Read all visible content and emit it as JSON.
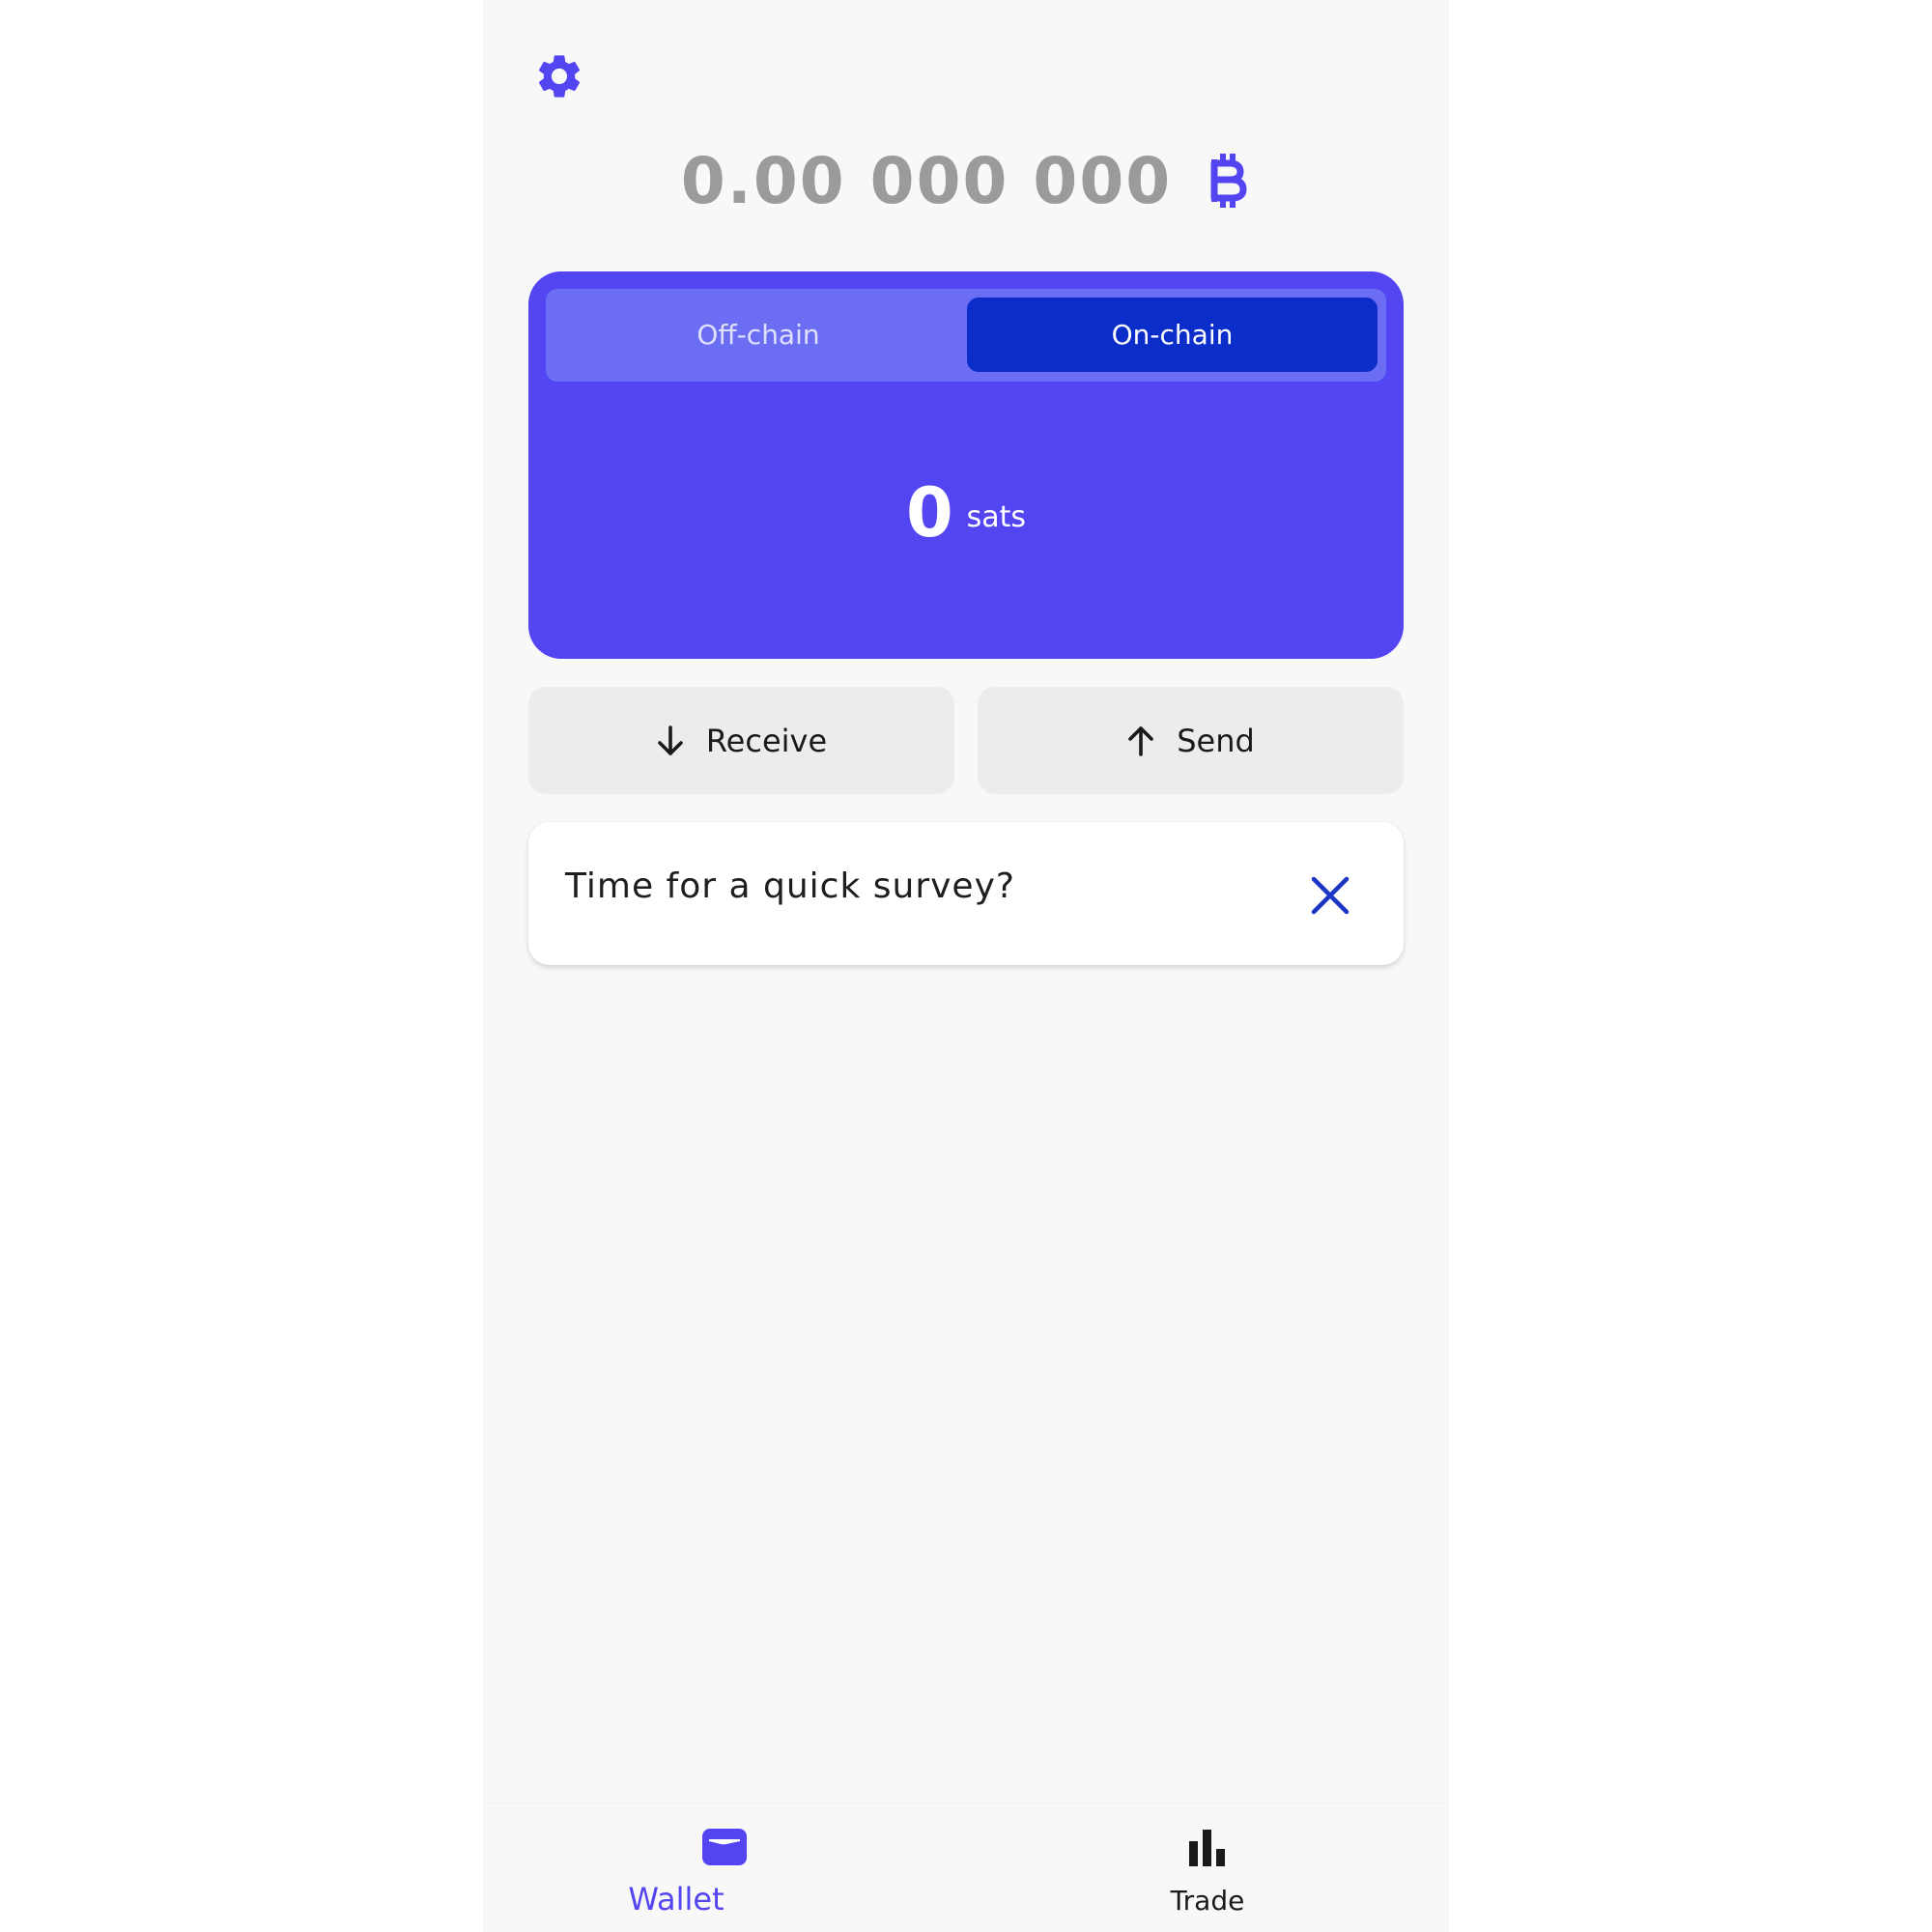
{
  "header": {
    "settings_icon": "gear-icon",
    "total_balance": "0.00 000 000",
    "currency_icon": "bitcoin-icon"
  },
  "balance_card": {
    "tabs": [
      {
        "label": "Off-chain",
        "selected": false
      },
      {
        "label": "On-chain",
        "selected": true
      }
    ],
    "amount": "0",
    "unit": "sats"
  },
  "actions": {
    "receive_label": "Receive",
    "receive_icon": "arrow-down-icon",
    "send_label": "Send",
    "send_icon": "arrow-up-icon"
  },
  "survey": {
    "text": "Time for a quick survey?",
    "close_icon": "close-icon"
  },
  "bottom_nav": {
    "items": [
      {
        "label": "Wallet",
        "icon": "wallet-icon",
        "active": true
      },
      {
        "label": "Trade",
        "icon": "bar-chart-icon",
        "active": false
      }
    ]
  },
  "colors": {
    "accent": "#5345f1",
    "segment_bg": "#6b6ef3",
    "segment_selected": "#0b2dc9",
    "muted_text": "#9b9b9b",
    "button_bg": "#ececec",
    "page_bg": "#f8f8f8"
  }
}
